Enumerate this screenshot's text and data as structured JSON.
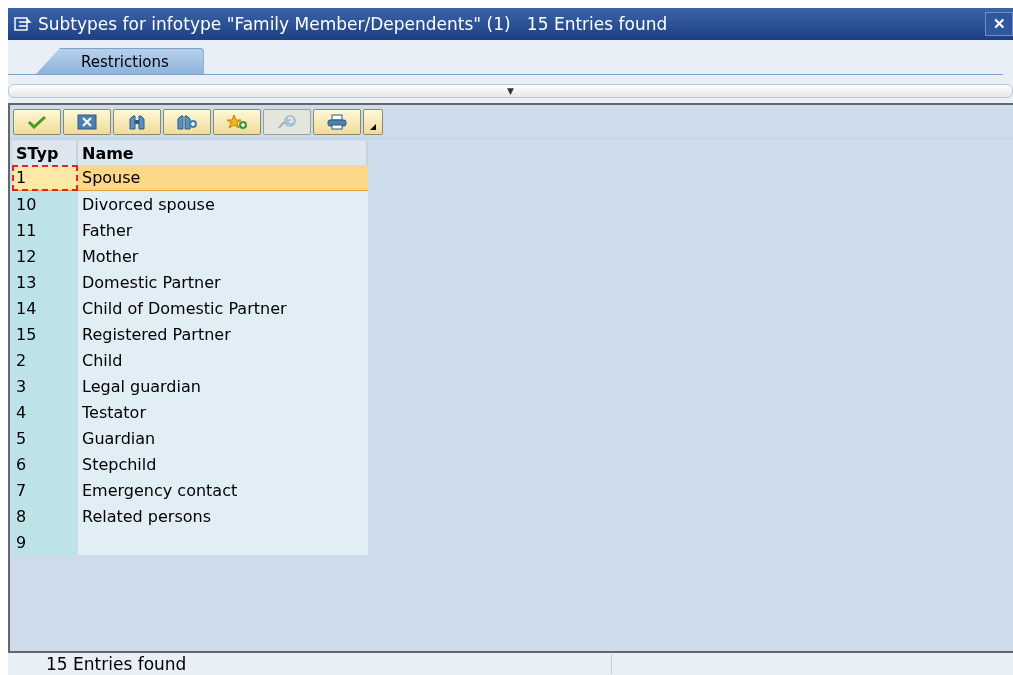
{
  "window": {
    "title": "Subtypes for infotype \"Family Member/Dependents\" (1)   15 Entries found",
    "close": "✕"
  },
  "tabs": [
    {
      "label": "Restrictions",
      "selected": true
    }
  ],
  "collapse_toggle": "▼",
  "toolbar": [
    {
      "kind": "ok",
      "disabled": false
    },
    {
      "kind": "cancel",
      "disabled": false
    },
    {
      "kind": "find",
      "disabled": false
    },
    {
      "kind": "find-next",
      "disabled": false
    },
    {
      "kind": "favorite-add",
      "disabled": false
    },
    {
      "kind": "help",
      "disabled": true
    },
    {
      "kind": "print",
      "disabled": false
    },
    {
      "kind": "menu",
      "disabled": false
    }
  ],
  "table": {
    "columns": [
      "STyp",
      "Name"
    ],
    "rows": [
      {
        "cells": [
          "1",
          "Spouse"
        ],
        "selected": true
      },
      {
        "cells": [
          "10",
          "Divorced spouse"
        ],
        "selected": false
      },
      {
        "cells": [
          "11",
          "Father"
        ],
        "selected": false
      },
      {
        "cells": [
          "12",
          "Mother"
        ],
        "selected": false
      },
      {
        "cells": [
          "13",
          "Domestic Partner"
        ],
        "selected": false
      },
      {
        "cells": [
          "14",
          "Child of Domestic Partner"
        ],
        "selected": false
      },
      {
        "cells": [
          "15",
          "Registered Partner"
        ],
        "selected": false
      },
      {
        "cells": [
          "2",
          "Child"
        ],
        "selected": false
      },
      {
        "cells": [
          "3",
          "Legal guardian"
        ],
        "selected": false
      },
      {
        "cells": [
          "4",
          "Testator"
        ],
        "selected": false
      },
      {
        "cells": [
          "5",
          "Guardian"
        ],
        "selected": false
      },
      {
        "cells": [
          "6",
          "Stepchild"
        ],
        "selected": false
      },
      {
        "cells": [
          "7",
          "Emergency contact"
        ],
        "selected": false
      },
      {
        "cells": [
          "8",
          "Related persons"
        ],
        "selected": false
      },
      {
        "cells": [
          "9",
          ""
        ],
        "selected": false
      }
    ]
  },
  "status_bar": "15 Entries found"
}
